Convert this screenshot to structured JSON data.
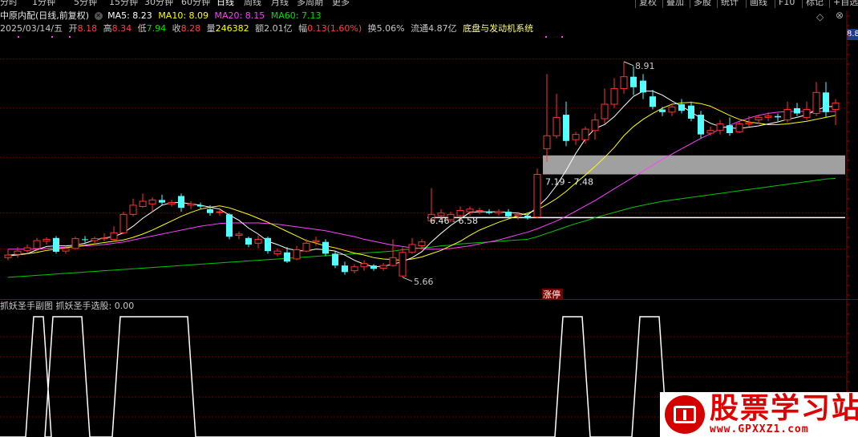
{
  "colors": {
    "up": "#ff3232",
    "down": "#54ffff",
    "ma5": "#ffffff",
    "ma10": "#ffff00",
    "ma20": "#ff40ff",
    "ma60": "#00c800",
    "grid": "#8b0000",
    "zone": "#a0a0a0",
    "signal": "#ffffff",
    "watermark": "#e00000"
  },
  "toolbar": {
    "periods": [
      "分时",
      "1分钟",
      "5分钟",
      "15分钟",
      "30分钟",
      "60分钟",
      "日线",
      "周线",
      "月线",
      "多周期",
      "更多"
    ],
    "active_period": "日线",
    "right_buttons": [
      "复权",
      "叠加",
      "多股",
      "统计",
      "画线",
      "F10",
      "标记",
      "+自选"
    ]
  },
  "header": {
    "stock_name": "中原内配(日线,前复权)",
    "ma5": "MA5: 8.23",
    "ma10": "MA10: 8.09",
    "ma20": "MA20: 8.15",
    "ma60": "MA60: 7.13",
    "date": "2025/03/14/五",
    "open_label": "开",
    "open": "8.18",
    "high_label": "高",
    "high": "8.34",
    "low_label": "低",
    "low": "7.94",
    "close_label": "收",
    "close": "8.28",
    "volume_label": "量",
    "volume": "246382",
    "amount_label": "额",
    "amount": "2.01亿",
    "change_label": "幅",
    "change": "0.13(1.60%)",
    "turnover": "换5.06%",
    "float": "流通4.87亿",
    "concept": "底盘与发动机系统",
    "price_tag": "8.8"
  },
  "annotations": {
    "high_label": "8.91",
    "low_label": "5.66",
    "zone_upper": "7.19 - 7.48",
    "zone_lower": "6.46 - 6.58",
    "limit_up": "涨停"
  },
  "sub_chart": {
    "title": "抓妖圣手副图",
    "indicator": "抓妖圣手选股: 0.00"
  },
  "watermark": {
    "name": "股票学习站",
    "url": "www.GPXXZ1.com"
  },
  "chart_data": {
    "type": "candlestick",
    "price_ylim": [
      5.3,
      9.3
    ],
    "candles": [
      {
        "o": 5.92,
        "h": 6.05,
        "l": 5.88,
        "c": 5.96
      },
      {
        "o": 5.97,
        "h": 6.08,
        "l": 5.92,
        "c": 6.02
      },
      {
        "o": 6.03,
        "h": 6.12,
        "l": 5.98,
        "c": 6.07
      },
      {
        "o": 6.06,
        "h": 6.22,
        "l": 6.02,
        "c": 6.18
      },
      {
        "o": 6.17,
        "h": 6.23,
        "l": 6.12,
        "c": 6.2
      },
      {
        "o": 6.22,
        "h": 6.25,
        "l": 5.98,
        "c": 6.01
      },
      {
        "o": 6.02,
        "h": 6.1,
        "l": 5.98,
        "c": 6.06
      },
      {
        "o": 6.06,
        "h": 6.24,
        "l": 6.04,
        "c": 6.21
      },
      {
        "o": 6.2,
        "h": 6.25,
        "l": 6.15,
        "c": 6.19
      },
      {
        "o": 6.18,
        "h": 6.24,
        "l": 6.12,
        "c": 6.21
      },
      {
        "o": 6.21,
        "h": 6.29,
        "l": 6.17,
        "c": 6.22
      },
      {
        "o": 6.2,
        "h": 6.4,
        "l": 6.18,
        "c": 6.3
      },
      {
        "o": 6.3,
        "h": 6.62,
        "l": 6.28,
        "c": 6.58
      },
      {
        "o": 6.58,
        "h": 6.82,
        "l": 6.55,
        "c": 6.72
      },
      {
        "o": 6.7,
        "h": 6.9,
        "l": 6.68,
        "c": 6.78
      },
      {
        "o": 6.74,
        "h": 6.84,
        "l": 6.62,
        "c": 6.8
      },
      {
        "o": 6.8,
        "h": 6.88,
        "l": 6.72,
        "c": 6.76
      },
      {
        "o": 6.74,
        "h": 6.8,
        "l": 6.7,
        "c": 6.76
      },
      {
        "o": 6.86,
        "h": 6.9,
        "l": 6.62,
        "c": 6.68
      },
      {
        "o": 6.72,
        "h": 6.78,
        "l": 6.66,
        "c": 6.74
      },
      {
        "o": 6.72,
        "h": 6.76,
        "l": 6.66,
        "c": 6.7
      },
      {
        "o": 6.66,
        "h": 6.72,
        "l": 6.56,
        "c": 6.6
      },
      {
        "o": 6.62,
        "h": 6.68,
        "l": 6.56,
        "c": 6.62
      },
      {
        "o": 6.58,
        "h": 6.6,
        "l": 6.2,
        "c": 6.24
      },
      {
        "o": 6.26,
        "h": 6.32,
        "l": 6.2,
        "c": 6.28
      },
      {
        "o": 6.22,
        "h": 6.24,
        "l": 6.08,
        "c": 6.12
      },
      {
        "o": 6.14,
        "h": 6.26,
        "l": 6.06,
        "c": 6.2
      },
      {
        "o": 6.22,
        "h": 6.24,
        "l": 5.98,
        "c": 6.02
      },
      {
        "o": 5.98,
        "h": 6.06,
        "l": 5.94,
        "c": 6.02
      },
      {
        "o": 6.0,
        "h": 6.08,
        "l": 5.84,
        "c": 5.86
      },
      {
        "o": 5.9,
        "h": 6.1,
        "l": 5.88,
        "c": 6.04
      },
      {
        "o": 6.02,
        "h": 6.2,
        "l": 6.0,
        "c": 6.14
      },
      {
        "o": 6.16,
        "h": 6.24,
        "l": 6.1,
        "c": 6.18
      },
      {
        "o": 6.16,
        "h": 6.2,
        "l": 5.94,
        "c": 5.98
      },
      {
        "o": 5.98,
        "h": 6.02,
        "l": 5.76,
        "c": 5.8
      },
      {
        "o": 5.8,
        "h": 5.86,
        "l": 5.66,
        "c": 5.7
      },
      {
        "o": 5.72,
        "h": 5.82,
        "l": 5.68,
        "c": 5.78
      },
      {
        "o": 5.78,
        "h": 5.88,
        "l": 5.72,
        "c": 5.83
      },
      {
        "o": 5.8,
        "h": 5.82,
        "l": 5.72,
        "c": 5.75
      },
      {
        "o": 5.76,
        "h": 5.84,
        "l": 5.72,
        "c": 5.8
      },
      {
        "o": 5.8,
        "h": 6.2,
        "l": 5.78,
        "c": 5.92
      },
      {
        "o": 5.64,
        "h": 6.08,
        "l": 5.62,
        "c": 6.0
      },
      {
        "o": 6.0,
        "h": 6.22,
        "l": 5.98,
        "c": 6.12
      },
      {
        "o": 6.1,
        "h": 6.2,
        "l": 6.04,
        "c": 6.16
      },
      {
        "o": 6.48,
        "h": 6.98,
        "l": 6.44,
        "c": 6.58
      },
      {
        "o": 6.56,
        "h": 6.66,
        "l": 6.5,
        "c": 6.6
      },
      {
        "o": 6.5,
        "h": 6.62,
        "l": 6.46,
        "c": 6.58
      },
      {
        "o": 6.56,
        "h": 6.7,
        "l": 6.5,
        "c": 6.64
      },
      {
        "o": 6.62,
        "h": 6.7,
        "l": 6.56,
        "c": 6.66
      },
      {
        "o": 6.64,
        "h": 6.68,
        "l": 6.58,
        "c": 6.64
      },
      {
        "o": 6.62,
        "h": 6.66,
        "l": 6.58,
        "c": 6.6
      },
      {
        "o": 6.6,
        "h": 6.66,
        "l": 6.56,
        "c": 6.62
      },
      {
        "o": 6.62,
        "h": 6.66,
        "l": 6.52,
        "c": 6.55
      },
      {
        "o": 6.56,
        "h": 6.62,
        "l": 6.5,
        "c": 6.58
      },
      {
        "o": 6.56,
        "h": 6.6,
        "l": 6.5,
        "c": 6.52
      },
      {
        "o": 6.54,
        "h": 7.28,
        "l": 6.52,
        "c": 7.19
      },
      {
        "o": 7.58,
        "h": 8.72,
        "l": 7.38,
        "c": 7.78
      },
      {
        "o": 7.78,
        "h": 8.42,
        "l": 7.74,
        "c": 8.06
      },
      {
        "o": 8.1,
        "h": 8.3,
        "l": 7.62,
        "c": 7.7
      },
      {
        "o": 7.72,
        "h": 7.84,
        "l": 7.64,
        "c": 7.8
      },
      {
        "o": 7.72,
        "h": 7.92,
        "l": 7.66,
        "c": 7.88
      },
      {
        "o": 7.86,
        "h": 8.12,
        "l": 7.72,
        "c": 8.02
      },
      {
        "o": 8.04,
        "h": 8.5,
        "l": 7.96,
        "c": 8.26
      },
      {
        "o": 8.26,
        "h": 8.66,
        "l": 8.2,
        "c": 8.5
      },
      {
        "o": 8.5,
        "h": 8.91,
        "l": 8.42,
        "c": 8.68
      },
      {
        "o": 8.68,
        "h": 8.84,
        "l": 8.4,
        "c": 8.52
      },
      {
        "o": 8.62,
        "h": 8.72,
        "l": 8.34,
        "c": 8.44
      },
      {
        "o": 8.38,
        "h": 8.48,
        "l": 8.18,
        "c": 8.22
      },
      {
        "o": 8.18,
        "h": 8.22,
        "l": 8.08,
        "c": 8.14
      },
      {
        "o": 8.14,
        "h": 8.28,
        "l": 8.08,
        "c": 8.22
      },
      {
        "o": 8.26,
        "h": 8.34,
        "l": 8.12,
        "c": 8.16
      },
      {
        "o": 8.24,
        "h": 8.3,
        "l": 8.0,
        "c": 8.04
      },
      {
        "o": 8.1,
        "h": 8.16,
        "l": 7.74,
        "c": 7.8
      },
      {
        "o": 7.82,
        "h": 7.92,
        "l": 7.78,
        "c": 7.86
      },
      {
        "o": 7.86,
        "h": 8.02,
        "l": 7.8,
        "c": 7.96
      },
      {
        "o": 7.94,
        "h": 8.06,
        "l": 7.78,
        "c": 7.82
      },
      {
        "o": 7.84,
        "h": 8.0,
        "l": 7.82,
        "c": 7.96
      },
      {
        "o": 7.96,
        "h": 8.08,
        "l": 7.92,
        "c": 7.98
      },
      {
        "o": 8.02,
        "h": 8.1,
        "l": 7.96,
        "c": 8.06
      },
      {
        "o": 8.06,
        "h": 8.14,
        "l": 8.0,
        "c": 8.08
      },
      {
        "o": 8.08,
        "h": 8.12,
        "l": 8.0,
        "c": 8.06
      },
      {
        "o": 8.02,
        "h": 8.3,
        "l": 7.98,
        "c": 8.18
      },
      {
        "o": 8.2,
        "h": 8.28,
        "l": 8.08,
        "c": 8.12
      },
      {
        "o": 8.06,
        "h": 8.3,
        "l": 8.02,
        "c": 8.18
      },
      {
        "o": 8.12,
        "h": 8.6,
        "l": 8.08,
        "c": 8.44
      },
      {
        "o": 8.44,
        "h": 8.6,
        "l": 8.06,
        "c": 8.14
      },
      {
        "o": 8.18,
        "h": 8.34,
        "l": 7.94,
        "c": 8.28
      }
    ],
    "ma5": [
      5.95,
      5.96,
      5.98,
      6.04,
      6.09,
      6.1,
      6.1,
      6.11,
      6.14,
      6.19,
      6.22,
      6.24,
      6.3,
      6.4,
      6.52,
      6.62,
      6.72,
      6.76,
      6.76,
      6.74,
      6.72,
      6.69,
      6.66,
      6.57,
      6.49,
      6.37,
      6.28,
      6.17,
      6.12,
      6.06,
      6.03,
      6.02,
      6.05,
      6.04,
      6.02,
      5.96,
      5.88,
      5.82,
      5.78,
      5.79,
      5.82,
      5.86,
      5.92,
      6.01,
      6.16,
      6.29,
      6.41,
      6.51,
      6.61,
      6.62,
      6.62,
      6.62,
      6.61,
      6.6,
      6.57,
      6.69,
      6.83,
      7.02,
      7.25,
      7.51,
      7.73,
      7.89,
      7.95,
      8.07,
      8.23,
      8.38,
      8.46,
      8.46,
      8.4,
      8.31,
      8.23,
      8.14,
      8.05,
      7.97,
      7.92,
      7.9,
      7.89,
      7.91,
      7.93,
      7.96,
      7.99,
      8.03,
      8.06,
      8.1,
      8.17,
      8.22,
      8.23
    ],
    "ma10": [
      5.96,
      5.97,
      5.98,
      6.0,
      6.03,
      6.05,
      6.07,
      6.09,
      6.11,
      6.13,
      6.15,
      6.17,
      6.19,
      6.23,
      6.28,
      6.34,
      6.41,
      6.48,
      6.55,
      6.61,
      6.66,
      6.69,
      6.71,
      6.68,
      6.63,
      6.58,
      6.52,
      6.46,
      6.39,
      6.32,
      6.25,
      6.18,
      6.14,
      6.1,
      6.07,
      6.03,
      5.99,
      5.96,
      5.92,
      5.9,
      5.89,
      5.88,
      5.9,
      5.93,
      5.98,
      6.03,
      6.1,
      6.17,
      6.26,
      6.34,
      6.4,
      6.46,
      6.51,
      6.56,
      6.6,
      6.65,
      6.73,
      6.82,
      6.93,
      7.06,
      7.18,
      7.31,
      7.45,
      7.6,
      7.78,
      7.92,
      8.03,
      8.12,
      8.2,
      8.26,
      8.28,
      8.29,
      8.27,
      8.23,
      8.16,
      8.09,
      8.03,
      7.99,
      7.97,
      7.95,
      7.95,
      7.96,
      7.98,
      8.0,
      8.03,
      8.06,
      8.09
    ],
    "ma20": [
      6.05,
      6.05,
      6.05,
      6.05,
      6.06,
      6.07,
      6.08,
      6.09,
      6.1,
      6.11,
      6.12,
      6.14,
      6.16,
      6.19,
      6.22,
      6.25,
      6.28,
      6.31,
      6.34,
      6.37,
      6.4,
      6.42,
      6.44,
      6.45,
      6.45,
      6.45,
      6.45,
      6.44,
      6.43,
      6.41,
      6.39,
      6.37,
      6.35,
      6.33,
      6.3,
      6.27,
      6.24,
      6.2,
      6.17,
      6.14,
      6.11,
      6.09,
      6.07,
      6.06,
      6.05,
      6.05,
      6.06,
      6.08,
      6.1,
      6.13,
      6.16,
      6.19,
      6.23,
      6.27,
      6.31,
      6.36,
      6.42,
      6.48,
      6.55,
      6.63,
      6.71,
      6.79,
      6.88,
      6.97,
      7.06,
      7.15,
      7.24,
      7.33,
      7.42,
      7.5,
      7.58,
      7.66,
      7.74,
      7.81,
      7.88,
      7.94,
      8.0,
      8.05,
      8.09,
      8.12,
      8.14,
      8.15,
      8.15,
      8.15,
      8.15,
      8.15,
      8.15
    ],
    "ma60": [
      5.62,
      5.63,
      5.64,
      5.65,
      5.66,
      5.67,
      5.68,
      5.69,
      5.7,
      5.71,
      5.72,
      5.73,
      5.74,
      5.75,
      5.76,
      5.77,
      5.78,
      5.79,
      5.8,
      5.81,
      5.82,
      5.83,
      5.84,
      5.85,
      5.86,
      5.87,
      5.88,
      5.89,
      5.9,
      5.91,
      5.92,
      5.93,
      5.94,
      5.95,
      5.96,
      5.97,
      5.98,
      5.99,
      6.0,
      6.01,
      6.02,
      6.04,
      6.05,
      6.07,
      6.08,
      6.1,
      6.11,
      6.13,
      6.14,
      6.15,
      6.16,
      6.17,
      6.18,
      6.19,
      6.2,
      6.24,
      6.29,
      6.34,
      6.39,
      6.44,
      6.48,
      6.53,
      6.57,
      6.61,
      6.65,
      6.69,
      6.72,
      6.75,
      6.78,
      6.8,
      6.82,
      6.84,
      6.86,
      6.88,
      6.9,
      6.92,
      6.94,
      6.96,
      6.98,
      7.0,
      7.02,
      7.04,
      7.06,
      7.08,
      7.1,
      7.12,
      7.13
    ],
    "zones": [
      {
        "label": "7.19 - 7.48",
        "low": 7.19,
        "high": 7.48,
        "from_index": 56
      },
      {
        "label": "6.46 - 6.58",
        "low": 6.46,
        "high": 6.58,
        "from_index": 44
      }
    ],
    "signal_segments": [
      {
        "from": 1,
        "to": 2
      },
      {
        "from": 3,
        "to": 6
      },
      {
        "from": 10,
        "to": 17
      },
      {
        "from": 56,
        "to": 58
      },
      {
        "from": 64,
        "to": 66
      }
    ]
  }
}
